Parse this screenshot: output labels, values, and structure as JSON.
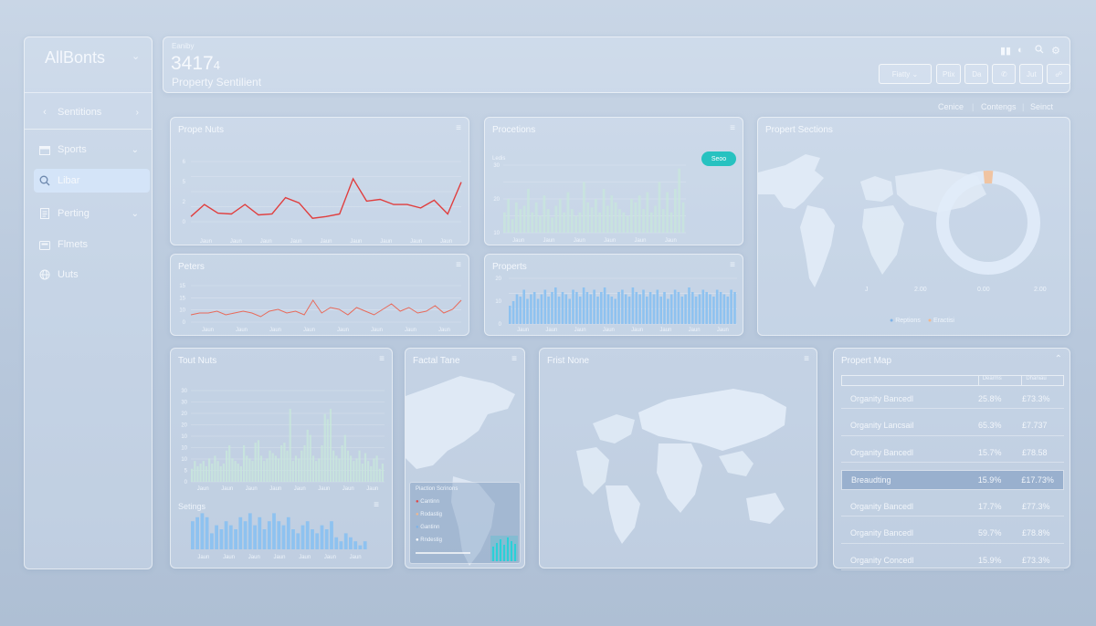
{
  "sidebar": {
    "brand": "AllBonts",
    "section": "Sentitions",
    "items": [
      {
        "label": "Sports",
        "icon": "calendar-icon",
        "chevron": true
      },
      {
        "label": "Libar",
        "icon": "search-icon",
        "chevron": false,
        "active": true
      },
      {
        "label": "Perting",
        "icon": "document-icon",
        "chevron": true
      },
      {
        "label": "Flmets",
        "icon": "folder-icon",
        "chevron": false
      },
      {
        "label": "Uuts",
        "icon": "globe-icon",
        "chevron": false
      }
    ]
  },
  "header": {
    "small_label": "Eaniby",
    "metric": "3417",
    "metric_suffix": "4",
    "subtitle": "Property Sentilient",
    "toolbar": [
      "Fiatty",
      "Ptix",
      "Da",
      "",
      "Jut",
      ""
    ]
  },
  "links": [
    "Cenice",
    "Contengs",
    "Seinct"
  ],
  "panels": {
    "prope_nuts": {
      "title": "Prope Nuts",
      "y_ticks": [
        "6",
        "5",
        "2",
        "0"
      ],
      "x_ticks": [
        "Jaun",
        "Jaun",
        "Jaun",
        "Jaun",
        "Jaun",
        "Jaun",
        "Jaun",
        "Jaun",
        "Jaun"
      ]
    },
    "procetions": {
      "title": "Procetions",
      "y_label": "Ledis",
      "y_ticks": [
        "30",
        "20",
        "10"
      ],
      "badge": "Seoo",
      "x_ticks": [
        "Jaun",
        "Jaun",
        "Jaun",
        "Jaun",
        "Jaun",
        "Jaun"
      ]
    },
    "peters": {
      "title": "Peters",
      "y_ticks": [
        "15",
        "15",
        "10",
        "0"
      ],
      "x_ticks": [
        "Jaun",
        "Jaun",
        "Jaun",
        "Jaun",
        "Jaun",
        "Jaun",
        "Jaun",
        "Jaun"
      ]
    },
    "properts": {
      "title": "Properts",
      "y_ticks": [
        "20",
        "10",
        "0"
      ],
      "x_ticks": [
        "Jaun",
        "Jaun",
        "Jaun",
        "Jaun",
        "Jaun",
        "Jaun",
        "Jaun",
        "Jaun"
      ]
    },
    "propert_sections": {
      "title": "Propert Sections",
      "map_ticks": [
        "J",
        "2.00",
        "0.00",
        "2.00"
      ],
      "legend": [
        "Reptions",
        "Eractisi"
      ],
      "donut_fraction": 0.03
    },
    "tout_nuts": {
      "title": "Tout Nuts",
      "y_ticks": [
        "30",
        "30",
        "20",
        "20",
        "10",
        "10",
        "10",
        "5",
        "0"
      ],
      "x_ticks": [
        "Jaun",
        "Jaun",
        "Jaun",
        "Jaun",
        "Jaun",
        "Jaun",
        "Jaun",
        "Jaun"
      ]
    },
    "setings": {
      "title": "Setings",
      "x_ticks": [
        "Jaun",
        "Jaun",
        "Jaun",
        "Jaun",
        "Jaun",
        "Jaun",
        "Jaun"
      ]
    },
    "factal_tane": {
      "title": "Factal Tane",
      "legend_title": "Piaction Scrinons",
      "legend": [
        "Cantinn",
        "Rodastig",
        "Gantinn",
        "Rndestig"
      ]
    },
    "first_none": {
      "title": "Frist None"
    },
    "propert_map": {
      "title": "Propert Map",
      "columns": [
        "",
        "Dearms",
        "Dhaniau"
      ],
      "rows": [
        [
          "Organity Bancedl",
          "25.8%",
          "£73.3%"
        ],
        [
          "Organity Lancsail",
          "65.3%",
          "£7.737"
        ],
        [
          "Organity Bancedl",
          "15.7%",
          "£78.58"
        ],
        [
          "Breaudting",
          "15.9%",
          "£17.73%"
        ],
        [
          "Organity Bancedl",
          "17.7%",
          "£77.3%"
        ],
        [
          "Organity Bancedl",
          "59.7%",
          "£78.8%"
        ],
        [
          "Organity Concedl",
          "15.9%",
          "£73.3%"
        ]
      ],
      "selected_row": 3
    }
  },
  "chart_data": [
    {
      "type": "line",
      "title": "Prope Nuts",
      "ylim": [
        0,
        7
      ],
      "series": [
        {
          "values": [
            0.6,
            2.0,
            1.0,
            0.9,
            2.0,
            0.8,
            0.9,
            2.8,
            2.2,
            0.4,
            0.6,
            0.9,
            5.0,
            2.4,
            2.6,
            2.0,
            2.0,
            1.6,
            2.5,
            0.9,
            4.6
          ]
        }
      ]
    },
    {
      "type": "bar",
      "title": "Procetions",
      "ylim": [
        0,
        40
      ],
      "values": [
        12,
        20,
        8,
        18,
        14,
        16,
        26,
        12,
        18,
        10,
        22,
        14,
        9,
        16,
        20,
        12,
        24,
        14,
        10,
        12,
        30,
        18,
        15,
        20,
        12,
        26,
        16,
        22,
        18,
        14,
        12,
        10,
        20,
        18,
        22,
        14,
        24,
        12,
        16,
        30,
        14,
        24,
        12,
        26,
        38,
        18
      ]
    },
    {
      "type": "line",
      "title": "Peters",
      "ylim": [
        0,
        20
      ],
      "series": [
        {
          "values": [
            4,
            5,
            5,
            6,
            4,
            5,
            6,
            5,
            3,
            6,
            7,
            5,
            6,
            4,
            12,
            5,
            8,
            7,
            4,
            8,
            6,
            4,
            7,
            10,
            6,
            8,
            5,
            6,
            9,
            5,
            7,
            12
          ]
        }
      ]
    },
    {
      "type": "bar",
      "title": "Properts",
      "ylim": [
        0,
        20
      ],
      "values": [
        8,
        10,
        13,
        12,
        15,
        11,
        13,
        14,
        11,
        13,
        15,
        12,
        14,
        16,
        12,
        14,
        13,
        11,
        15,
        14,
        12,
        16,
        14,
        13,
        15,
        12,
        14,
        16,
        13,
        12,
        11,
        14,
        15,
        13,
        12,
        16,
        14,
        13,
        15,
        12,
        14,
        13,
        15,
        12,
        14,
        11,
        13,
        15,
        14,
        12,
        13,
        16,
        14,
        12,
        13,
        15,
        14,
        13,
        12,
        15,
        14,
        13,
        12,
        15,
        14
      ]
    },
    {
      "type": "bar",
      "title": "Tout Nuts",
      "ylim": [
        0,
        35
      ],
      "values": [
        5,
        8,
        6,
        7,
        8,
        6,
        9,
        7,
        10,
        8,
        6,
        7,
        12,
        14,
        9,
        8,
        7,
        6,
        14,
        10,
        9,
        8,
        15,
        16,
        10,
        8,
        9,
        12,
        11,
        10,
        9,
        14,
        15,
        12,
        28,
        8,
        10,
        9,
        12,
        14,
        20,
        18,
        10,
        8,
        9,
        14,
        26,
        24,
        28,
        12,
        10,
        9,
        14,
        18,
        12,
        10,
        8,
        9,
        12,
        7,
        11,
        8,
        6,
        9,
        10,
        5,
        7
      ]
    },
    {
      "type": "bar",
      "title": "Setings",
      "ylim": [
        0,
        10
      ],
      "values": [
        7,
        8,
        9,
        8,
        4,
        6,
        5,
        7,
        6,
        5,
        8,
        7,
        9,
        6,
        8,
        5,
        7,
        9,
        7,
        6,
        8,
        5,
        4,
        6,
        7,
        5,
        4,
        6,
        5,
        7,
        3,
        2,
        4,
        3,
        2,
        1,
        2
      ]
    },
    {
      "type": "pie",
      "title": "Propert Sections",
      "values": [
        3,
        97
      ]
    }
  ]
}
